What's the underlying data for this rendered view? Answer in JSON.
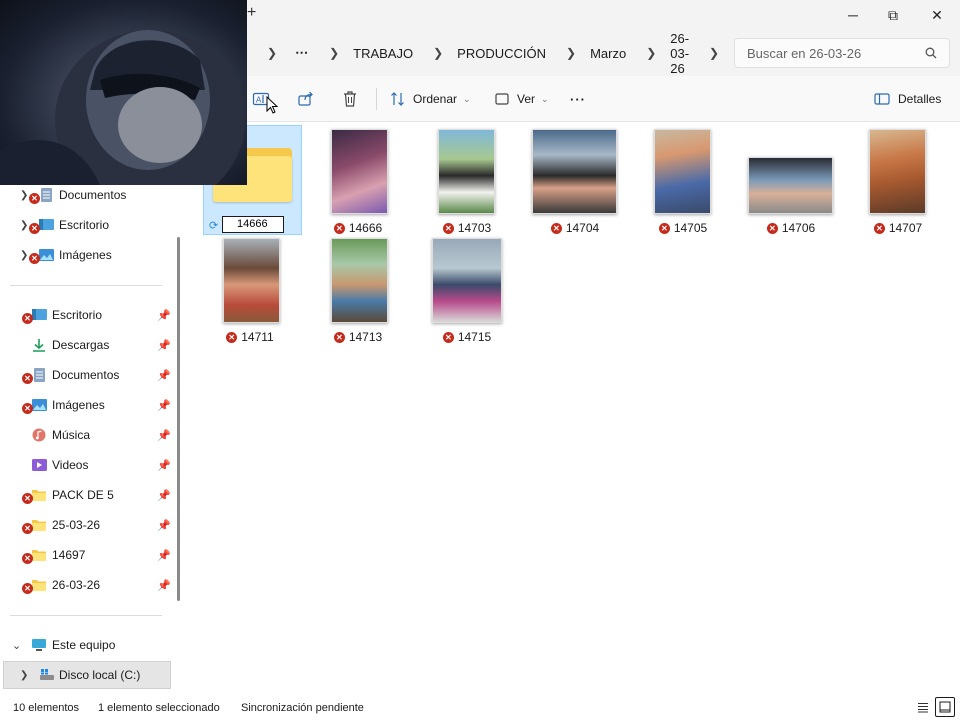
{
  "titlebar": {
    "new_tab": "+",
    "minimize": "─",
    "restore": "⧉",
    "close": "✕"
  },
  "address": {
    "overflow": "⋯",
    "breadcrumbs": [
      "TRABAJO",
      "PRODUCCIÓN",
      "Marzo",
      "26-03-26"
    ],
    "search_placeholder": "Buscar en 26-03-26"
  },
  "commands": {
    "sort": "Ordenar",
    "view": "Ver",
    "more": "···",
    "details": "Detalles"
  },
  "nav": {
    "top_items": [
      {
        "label": "Documentos",
        "icon": "document-icon",
        "status": "error"
      },
      {
        "label": "Escritorio",
        "icon": "desktop-icon",
        "status": "error"
      },
      {
        "label": "Imágenes",
        "icon": "pictures-icon",
        "status": "error"
      }
    ],
    "quick_access": [
      {
        "label": "Escritorio",
        "icon": "desktop-icon",
        "status": "error"
      },
      {
        "label": "Descargas",
        "icon": "download-icon",
        "status": "none"
      },
      {
        "label": "Documentos",
        "icon": "document-icon",
        "status": "error"
      },
      {
        "label": "Imágenes",
        "icon": "pictures-icon",
        "status": "error"
      },
      {
        "label": "Música",
        "icon": "music-icon",
        "status": "none"
      },
      {
        "label": "Videos",
        "icon": "video-icon",
        "status": "none"
      },
      {
        "label": "PACK DE 5",
        "icon": "folder-icon",
        "status": "error"
      },
      {
        "label": "25-03-26",
        "icon": "folder-icon",
        "status": "error"
      },
      {
        "label": "14697",
        "icon": "folder-icon",
        "status": "error"
      },
      {
        "label": "26-03-26",
        "icon": "folder-icon",
        "status": "error"
      }
    ],
    "this_pc": "Este equipo",
    "local_disk": "Disco local (C:)"
  },
  "files": {
    "rename_value": "14666",
    "items": [
      "14666",
      "14703",
      "14704",
      "14705",
      "14706",
      "14707",
      "14711",
      "14713",
      "14715"
    ]
  },
  "status": {
    "count": "10 elementos",
    "selected": "1 elemento seleccionado",
    "sync": "Sincronización pendiente"
  },
  "colors": {
    "accent": "#0067c0",
    "error": "#c42b1c",
    "selection": "#cce8ff",
    "folder": "#f5c84c"
  }
}
